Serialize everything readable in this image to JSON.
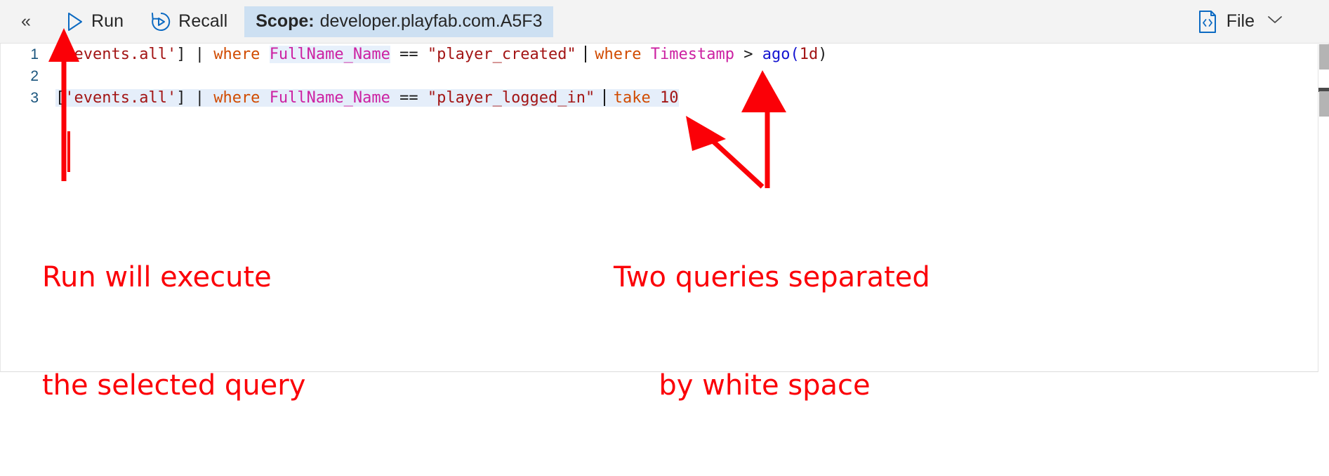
{
  "toolbar": {
    "collapse_label": "«",
    "collapse_name": "collapse-panel-icon",
    "run_label": "Run",
    "run_icon": "play-triangle-icon",
    "recall_label": "Recall",
    "recall_icon": "recall-history-icon",
    "scope_key": "Scope:",
    "scope_value": "developer.playfab.com.A5F3",
    "file_label": "File",
    "file_icon": "code-file-icon",
    "file_chevron": "chevron-down-icon",
    "accent_blue": "#0c6ac2",
    "scope_bg": "#cde0f2"
  },
  "editor": {
    "language": "kusto",
    "selection_color": "#e5eefa",
    "line_number_color": "#19547c",
    "lines": [
      {
        "number": "1",
        "selected": false,
        "tokens": [
          {
            "text": "[",
            "cls": "t-punct"
          },
          {
            "text": "'events.all'",
            "cls": "t-str"
          },
          {
            "text": "]",
            "cls": "t-punct"
          },
          {
            "text": " | ",
            "cls": "t-pipe"
          },
          {
            "text": "where",
            "cls": "t-kw"
          },
          {
            "text": " ",
            "cls": "t-op"
          },
          {
            "text": "FullName_Name",
            "cls": "t-colhl"
          },
          {
            "text": " == ",
            "cls": "t-op"
          },
          {
            "text": "\"player_created\"",
            "cls": "t-strlit"
          },
          {
            "text": " ",
            "cls": "t-op"
          },
          {
            "text": "|",
            "cls": "t-cursor"
          },
          {
            "text": " ",
            "cls": "t-op"
          },
          {
            "text": "where",
            "cls": "t-kw"
          },
          {
            "text": " ",
            "cls": "t-op"
          },
          {
            "text": "Timestamp",
            "cls": "t-col"
          },
          {
            "text": " > ",
            "cls": "t-op"
          },
          {
            "text": "ago(",
            "cls": "t-fn"
          },
          {
            "text": "1d",
            "cls": "t-num"
          },
          {
            "text": ")",
            "cls": "t-punct"
          }
        ]
      },
      {
        "number": "2",
        "selected": false,
        "tokens": []
      },
      {
        "number": "3",
        "selected": true,
        "tokens": [
          {
            "text": "[",
            "cls": "t-punct"
          },
          {
            "text": "'events.all'",
            "cls": "t-str"
          },
          {
            "text": "]",
            "cls": "t-punct"
          },
          {
            "text": " | ",
            "cls": "t-pipe"
          },
          {
            "text": "where",
            "cls": "t-kw"
          },
          {
            "text": " ",
            "cls": "t-op"
          },
          {
            "text": "FullName_Name",
            "cls": "t-col"
          },
          {
            "text": " == ",
            "cls": "t-op"
          },
          {
            "text": "\"player_logged_in\"",
            "cls": "t-strlit"
          },
          {
            "text": " ",
            "cls": "t-op"
          },
          {
            "text": "|",
            "cls": "t-cursor"
          },
          {
            "text": " ",
            "cls": "t-op"
          },
          {
            "text": "take",
            "cls": "t-kw"
          },
          {
            "text": " ",
            "cls": "t-op"
          },
          {
            "text": "10",
            "cls": "t-num"
          }
        ]
      }
    ]
  },
  "annotations": {
    "color": "#fb0007",
    "left": {
      "line1": "Run will execute",
      "line2": "the selected query"
    },
    "right": {
      "line1": "Two queries separated",
      "line2": "by white space"
    }
  },
  "scrollbar": {
    "name": "vertical-scrollbar"
  }
}
